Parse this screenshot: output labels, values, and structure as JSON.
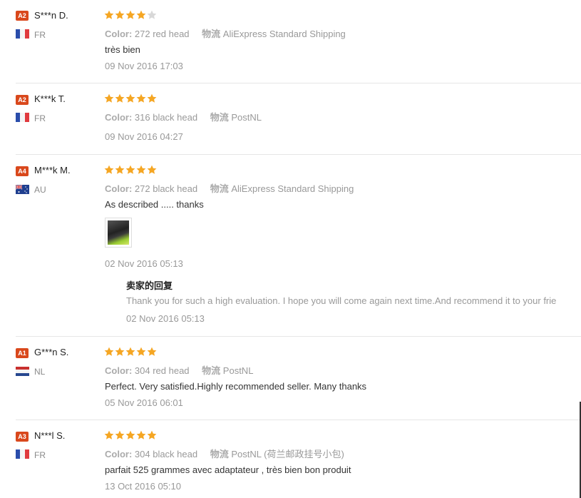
{
  "colors": {
    "star_full": "#f5a623",
    "star_empty": "#d8d8d8",
    "level_badge": "#d9481c"
  },
  "labels": {
    "color": "Color:",
    "shipping": "物流"
  },
  "reviews": [
    {
      "level": "A2",
      "name": "S***n D.",
      "country": "FR",
      "rating": 4,
      "color": "272 red head",
      "shipping": "AliExpress Standard Shipping",
      "text": "très bien",
      "date": "09 Nov 2016 17:03"
    },
    {
      "level": "A2",
      "name": "K***k T.",
      "country": "FR",
      "rating": 5,
      "color": "316 black head",
      "shipping": "PostNL",
      "text": "",
      "date": "09 Nov 2016 04:27"
    },
    {
      "level": "A4",
      "name": "M***k M.",
      "country": "AU",
      "rating": 5,
      "color": "272 black head",
      "shipping": "AliExpress Standard Shipping",
      "text": "As described ..... thanks",
      "date": "02 Nov 2016 05:13",
      "reply": {
        "title": "卖家的回复",
        "text": "Thank you for such a high evaluation. I hope you will come again next time.And recommend it to your frie",
        "date": "02 Nov 2016 05:13"
      }
    },
    {
      "level": "A1",
      "name": "G***n S.",
      "country": "NL",
      "rating": 5,
      "color": "304 red head",
      "shipping": "PostNL",
      "text": "Perfect. Very satisfied.Highly recommended seller. Many thanks",
      "date": "05 Nov 2016 06:01"
    },
    {
      "level": "A3",
      "name": "N***l S.",
      "country": "FR",
      "rating": 5,
      "color": "304 black head",
      "shipping": "PostNL (荷兰邮政挂号小包)",
      "text": "parfait 525 grammes avec adaptateur , très bien bon produit",
      "date": "13 Oct 2016 05:10"
    }
  ]
}
